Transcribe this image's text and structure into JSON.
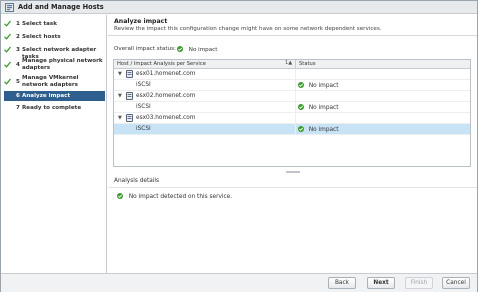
{
  "window": {
    "title": "Add and Manage Hosts"
  },
  "steps": [
    {
      "num": "1",
      "label": "Select task",
      "done": true
    },
    {
      "num": "2",
      "label": "Select hosts",
      "done": true
    },
    {
      "num": "3",
      "label": "Select network adapter tasks",
      "done": true
    },
    {
      "num": "4",
      "label": "Manage physical network adapters",
      "done": true
    },
    {
      "num": "5",
      "label": "Manage VMkernel network adapters",
      "done": true
    },
    {
      "num": "6",
      "label": "Analyze impact",
      "done": false,
      "active": true
    },
    {
      "num": "7",
      "label": "Ready to complete",
      "done": false
    }
  ],
  "header": {
    "title": "Analyze impact",
    "subtitle": "Review the impact this configuration change might have on some network dependent services."
  },
  "overall": {
    "label": "Overall impact status:",
    "value": "No impact"
  },
  "grid": {
    "col_host": "Host / Impact Analysis per Service",
    "sort_indicator": "1▲",
    "col_status": "Status",
    "rows": [
      {
        "type": "host",
        "name": "esx01.homenet.com"
      },
      {
        "type": "service",
        "name": "iSCSI",
        "status": "No impact"
      },
      {
        "type": "host",
        "name": "esx02.homenet.com"
      },
      {
        "type": "service",
        "name": "iSCSI",
        "status": "No impact"
      },
      {
        "type": "host",
        "name": "esx03.homenet.com"
      },
      {
        "type": "service",
        "name": "iSCSI",
        "status": "No impact",
        "selected": true
      }
    ]
  },
  "details": {
    "title": "Analysis details",
    "message": "No impact detected on this service."
  },
  "footer": {
    "back": "Back",
    "next": "Next",
    "finish": "Finish",
    "cancel": "Cancel"
  },
  "colors": {
    "ok_green": "#3c9a2e",
    "active_step": "#2e5f8f",
    "selected_row": "#c9e3f6"
  }
}
